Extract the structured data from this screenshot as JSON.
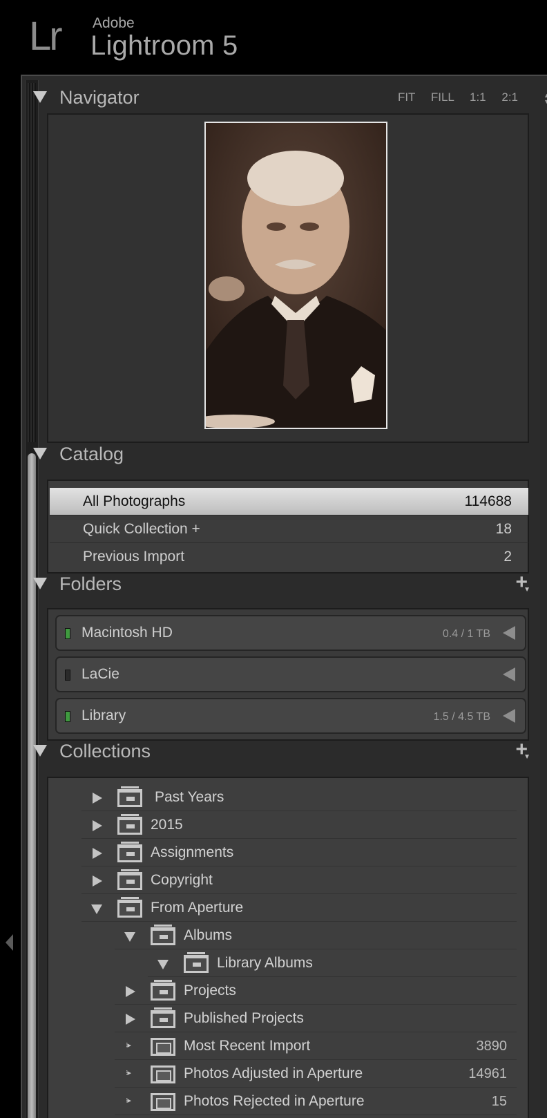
{
  "app": {
    "logo": "Lr",
    "vendor": "Adobe",
    "product": "Lightroom 5"
  },
  "navigator": {
    "title": "Navigator",
    "zoom_options": [
      "FIT",
      "FILL",
      "1:1",
      "2:1"
    ]
  },
  "catalog": {
    "title": "Catalog",
    "items": [
      {
        "label": "All Photographs",
        "count": "114688",
        "selected": true
      },
      {
        "label": "Quick Collection  +",
        "count": "18"
      },
      {
        "label": "Previous Import",
        "count": "2"
      }
    ]
  },
  "folders": {
    "title": "Folders",
    "add_button": "+",
    "volumes": [
      {
        "name": "Macintosh HD",
        "size": "0.4 / 1 TB",
        "status_color": "#3f9a3f"
      },
      {
        "name": "LaCie",
        "size": "",
        "status_color": "#2a2a2a"
      },
      {
        "name": "Library",
        "size": "1.5 / 4.5 TB",
        "status_color": "#3f9a3f"
      }
    ]
  },
  "collections": {
    "title": "Collections",
    "add_button": "+",
    "items": [
      {
        "label": "Past Years",
        "count": "",
        "type": "set",
        "expanded": false
      },
      {
        "label": "2015",
        "count": "",
        "type": "set",
        "expanded": false
      },
      {
        "label": "Assignments",
        "count": "",
        "type": "set",
        "expanded": false
      },
      {
        "label": "Copyright",
        "count": "",
        "type": "set",
        "expanded": false
      },
      {
        "label": "From Aperture",
        "count": "",
        "type": "set",
        "expanded": true
      },
      {
        "label": "Albums",
        "count": "",
        "type": "set",
        "expanded": true
      },
      {
        "label": "Library Albums",
        "count": "",
        "type": "set",
        "expanded": true
      },
      {
        "label": "Projects",
        "count": "",
        "type": "set",
        "expanded": false
      },
      {
        "label": "Published Projects",
        "count": "",
        "type": "set",
        "expanded": false
      },
      {
        "label": "Most Recent Import",
        "count": "3890",
        "type": "smart"
      },
      {
        "label": "Photos Adjusted in Aperture",
        "count": "14961",
        "type": "smart"
      },
      {
        "label": "Photos Rejected in Aperture",
        "count": "15",
        "type": "smart"
      }
    ]
  },
  "colors": {
    "panel_bg": "#2b2b2b",
    "selected_row": "#d0d0d0",
    "online_indicator": "#3f9a3f"
  }
}
